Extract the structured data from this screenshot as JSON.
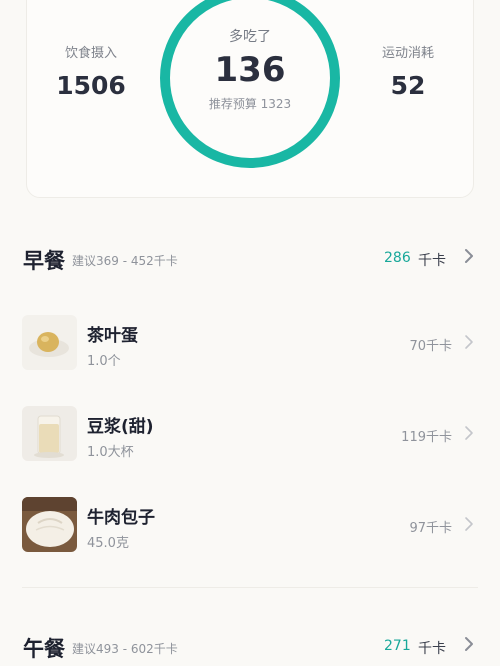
{
  "summary": {
    "intake_label": "饮食摄入",
    "intake_value": "1506",
    "ring_label": "多吃了",
    "ring_value": "136",
    "ring_sub": "推荐预算 1323",
    "burn_label": "运动消耗",
    "burn_value": "52"
  },
  "breakfast": {
    "title": "早餐",
    "range": "建议369 - 452千卡",
    "kcal": "286",
    "unit": "千卡",
    "items": [
      {
        "name": "茶叶蛋",
        "qty": "1.0个",
        "kcal": "70千卡"
      },
      {
        "name": "豆浆(甜)",
        "qty": "1.0大杯",
        "kcal": "119千卡"
      },
      {
        "name": "牛肉包子",
        "qty": "45.0克",
        "kcal": "97千卡"
      }
    ]
  },
  "lunch": {
    "title": "午餐",
    "range": "建议493 - 602千卡",
    "kcal": "271",
    "unit": "千卡"
  },
  "colors": {
    "accent": "#19b7a4",
    "accent_text": "#19a89a",
    "background": "#faf9f6"
  }
}
